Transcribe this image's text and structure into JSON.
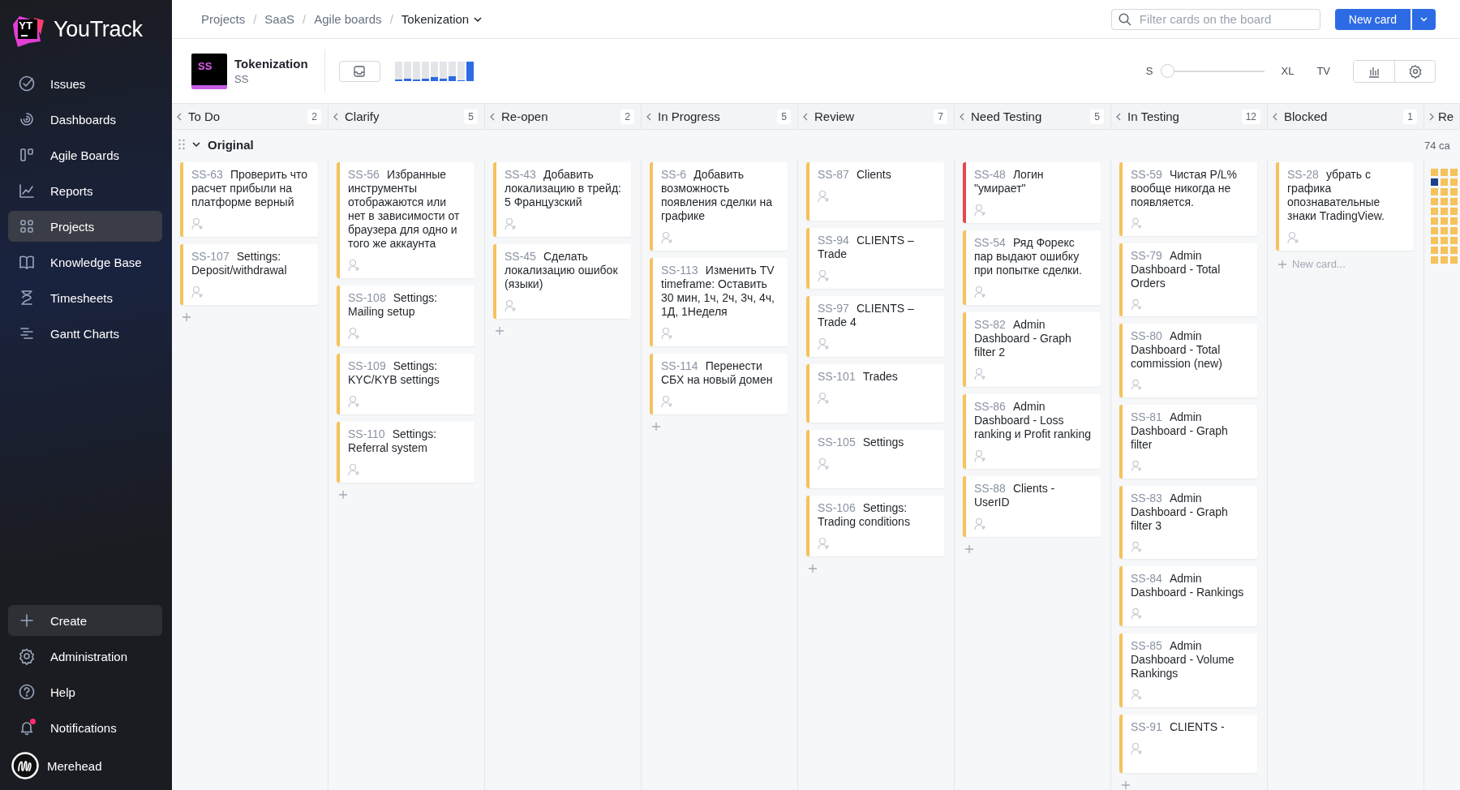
{
  "sidebar": {
    "logo_mark": "YT",
    "logo": "YouTrack",
    "items": [
      {
        "label": "Issues",
        "selected": false
      },
      {
        "label": "Dashboards",
        "selected": false
      },
      {
        "label": "Agile Boards",
        "selected": false
      },
      {
        "label": "Reports",
        "selected": false
      },
      {
        "label": "Projects",
        "selected": true
      },
      {
        "label": "Knowledge Base",
        "selected": false
      },
      {
        "label": "Timesheets",
        "selected": false
      },
      {
        "label": "Gantt Charts",
        "selected": false
      }
    ],
    "bottom_items": [
      {
        "label": "Create",
        "kind": "create"
      },
      {
        "label": "Administration",
        "kind": "admin"
      },
      {
        "label": "Help",
        "kind": "help"
      },
      {
        "label": "Notifications",
        "kind": "notifications",
        "unread": true
      }
    ],
    "user": {
      "name": "Merehead"
    }
  },
  "breadcrumbs": {
    "separator": "/",
    "items": [
      "Projects",
      "SaaS",
      "Agile boards",
      "Tokenization"
    ]
  },
  "search": {
    "placeholder": "Filter cards on the board"
  },
  "new_card_button": "New card",
  "project": {
    "avatar": "SS",
    "name": "Tokenization",
    "key": "SS"
  },
  "size_slider": {
    "min_label": "S",
    "max_label": "XL",
    "level": 0
  },
  "tv_label": "TV",
  "columns": [
    {
      "title": "To Do",
      "count": "2",
      "cards": [
        {
          "id": "SS-63",
          "summary": "Проверить что расчет прибыли на платформе верный",
          "color": "#f6c25c"
        },
        {
          "id": "SS-107",
          "summary": "Settings: Deposit/withdrawal",
          "color": "#f6c25c"
        }
      ]
    },
    {
      "title": "Clarify",
      "count": "5",
      "cards": [
        {
          "id": "SS-56",
          "summary": "Избранные инструменты отображаются или нет в зависимости от браузера для одно и того же аккаунта",
          "color": "#f6c25c"
        },
        {
          "id": "SS-108",
          "summary": "Settings: Mailing setup",
          "color": "#f6c25c"
        },
        {
          "id": "SS-109",
          "summary": "Settings: KYC/KYB settings",
          "color": "#f6c25c"
        },
        {
          "id": "SS-110",
          "summary": "Settings: Referral system",
          "color": "#f6c25c"
        }
      ]
    },
    {
      "title": "Re-open",
      "count": "2",
      "cards": [
        {
          "id": "SS-43",
          "summary": "Добавить локализацию в трейд: 5 Французский",
          "color": "#f6c25c"
        },
        {
          "id": "SS-45",
          "summary": "Сделать локализацию ошибок (языки)",
          "color": "#f6c25c"
        }
      ]
    },
    {
      "title": "In Progress",
      "count": "5",
      "cards": [
        {
          "id": "SS-6",
          "summary": "Добавить возможность появления сделки на графике",
          "color": "#f6c25c"
        },
        {
          "id": "SS-113",
          "summary": "Изменить TV timeframe: Оставить 30 мин, 1ч, 2ч, 3ч, 4ч, 1Д, 1Неделя",
          "color": "#f6c25c"
        },
        {
          "id": "SS-114",
          "summary": "Перенести CБХ на новый домен",
          "color": "#f6c25c"
        }
      ]
    },
    {
      "title": "Review",
      "count": "7",
      "cards": [
        {
          "id": "SS-87",
          "summary": "Clients",
          "color": "#f6c25c"
        },
        {
          "id": "SS-94",
          "summary": "CLIENTS – Trade",
          "color": "#f6c25c"
        },
        {
          "id": "SS-97",
          "summary": "CLIENTS – Trade 4",
          "color": "#f6c25c"
        },
        {
          "id": "SS-101",
          "summary": "Trades",
          "color": "#f6c25c"
        },
        {
          "id": "SS-105",
          "summary": "Settings",
          "color": "#f6c25c"
        },
        {
          "id": "SS-106",
          "summary": "Settings: Trading conditions",
          "color": "#f6c25c"
        }
      ]
    },
    {
      "title": "Need Testing",
      "count": "5",
      "cards": [
        {
          "id": "SS-48",
          "summary": "Логин \"умирает\"",
          "color": "#e5484d"
        },
        {
          "id": "SS-54",
          "summary": "Ряд Форекс пар выдают ошибку при попытке сделки.",
          "color": "#f6c25c"
        },
        {
          "id": "SS-82",
          "summary": "Admin Dashboard - Graph filter 2",
          "color": "#f6c25c"
        },
        {
          "id": "SS-86",
          "summary": "Admin Dashboard - Loss ranking и Profit ranking",
          "color": "#f6c25c"
        },
        {
          "id": "SS-88",
          "summary": "Clients - UserID",
          "color": "#f6c25c"
        }
      ]
    },
    {
      "title": "In Testing",
      "count": "12",
      "cards": [
        {
          "id": "SS-59",
          "summary": "Чистая P/L% вообще никогда не появляется.",
          "color": "#f6c25c"
        },
        {
          "id": "SS-79",
          "summary": "Admin Dashboard - Total Orders",
          "color": "#f6c25c"
        },
        {
          "id": "SS-80",
          "summary": "Admin Dashboard - Total commission (new)",
          "color": "#f6c25c"
        },
        {
          "id": "SS-81",
          "summary": "Admin Dashboard - Graph filter",
          "color": "#f6c25c"
        },
        {
          "id": "SS-83",
          "summary": "Admin Dashboard - Graph filter 3",
          "color": "#f6c25c"
        },
        {
          "id": "SS-84",
          "summary": "Admin Dashboard - Rankings",
          "color": "#f6c25c"
        },
        {
          "id": "SS-85",
          "summary": "Admin Dashboard - Volume Rankings",
          "color": "#f6c25c"
        },
        {
          "id": "SS-91",
          "summary": "CLIENTS -",
          "color": "#f6c25c"
        }
      ]
    },
    {
      "title": "Blocked",
      "count": "1",
      "add_label": "New card...",
      "cards": [
        {
          "id": "SS-28",
          "summary": "убрать с графика опознавательные знаки TradingView.",
          "color": "#f6c25c"
        }
      ]
    }
  ],
  "partial_column": {
    "title": "Re"
  },
  "swimlane": {
    "title": "Original",
    "expanded": true,
    "card_count": "74 ca"
  }
}
